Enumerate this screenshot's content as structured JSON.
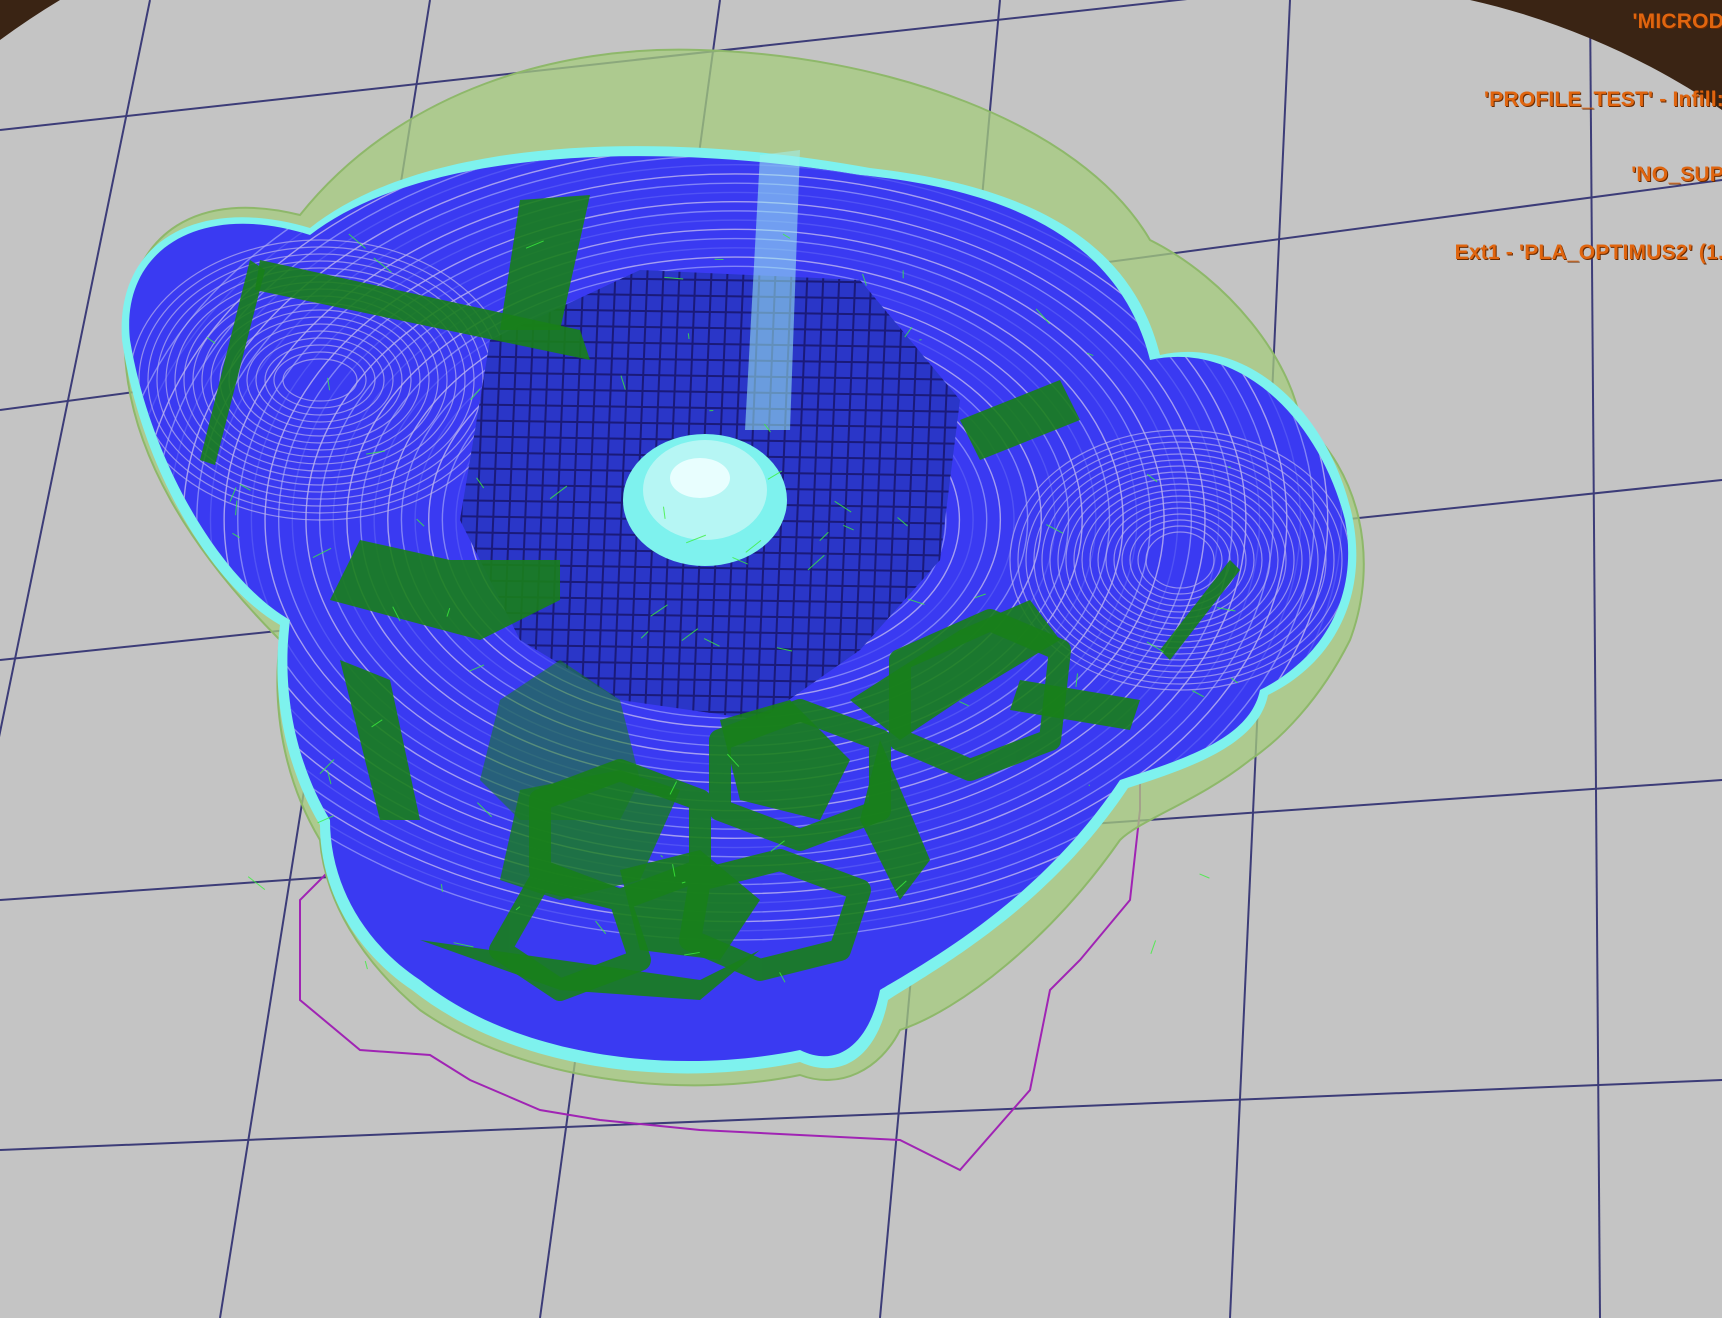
{
  "overlay": {
    "lines": [
      "'MICROD",
      "'PROFILE_TEST' - Infill:",
      "'NO_SUP",
      "Ext1 - 'PLA_OPTIMUS2' (1."
    ],
    "color": "#e0650f"
  },
  "colors": {
    "background": "#c4c4c4",
    "grid_line": "#3c3c78",
    "bed_ring": "#3a2414",
    "model_shell": "#a6cc7e",
    "outer_perimeter": "#7ef2ee",
    "inner_perimeter": "#3a3af2",
    "infill": "#18801a",
    "support_grid": "#1a1a7a",
    "top_cap": "#b6f6f4",
    "travel_path": "#a024b4"
  }
}
